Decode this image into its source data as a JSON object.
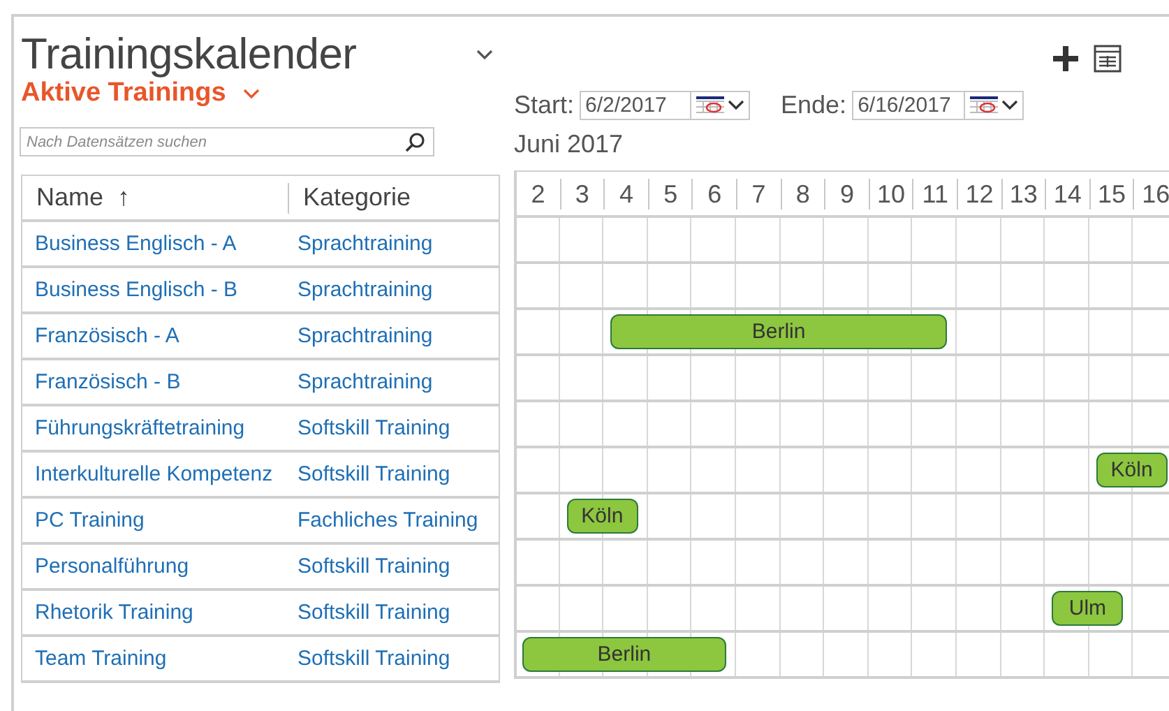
{
  "header": {
    "title": "Trainingskalender",
    "view": "Aktive Trainings"
  },
  "search": {
    "placeholder": "Nach Datensätzen suchen"
  },
  "filters": {
    "start_label": "Start:",
    "start_value": "6/2/2017",
    "end_label": "Ende:",
    "end_value": "6/16/2017"
  },
  "month": "Juni 2017",
  "table": {
    "columns": [
      {
        "label": "Name",
        "sort": "↑"
      },
      {
        "label": "Kategorie"
      }
    ],
    "rows": [
      {
        "name": "Business Englisch - A",
        "category": "Sprachtraining",
        "events": []
      },
      {
        "name": "Business Englisch - B",
        "category": "Sprachtraining",
        "events": []
      },
      {
        "name": "Französisch - A",
        "category": "Sprachtraining",
        "events": [
          {
            "label": "Berlin",
            "covers": [
              false,
              false,
              true,
              true,
              true,
              true,
              true,
              true,
              true,
              true,
              false,
              false,
              false,
              false,
              false
            ]
          }
        ]
      },
      {
        "name": "Französisch - B",
        "category": "Sprachtraining",
        "events": []
      },
      {
        "name": "Führungskräftetraining",
        "category": "Softskill Training",
        "events": []
      },
      {
        "name": "Interkulturelle Kompetenz",
        "category": "Softskill Training",
        "events": [
          {
            "label": "Köln",
            "covers": [
              false,
              false,
              false,
              false,
              false,
              false,
              false,
              false,
              false,
              false,
              false,
              false,
              false,
              true,
              true
            ]
          }
        ]
      },
      {
        "name": "PC Training",
        "category": "Fachliches Training",
        "events": [
          {
            "label": "Köln",
            "covers": [
              false,
              true,
              true,
              false,
              false,
              false,
              false,
              false,
              false,
              false,
              false,
              false,
              false,
              false,
              false
            ]
          }
        ]
      },
      {
        "name": "Personalführung",
        "category": "Softskill Training",
        "events": []
      },
      {
        "name": "Rhetorik Training",
        "category": "Softskill Training",
        "events": [
          {
            "label": "Ulm",
            "covers": [
              false,
              false,
              false,
              false,
              false,
              false,
              false,
              false,
              false,
              false,
              false,
              false,
              true,
              true,
              false
            ]
          }
        ]
      },
      {
        "name": "Team Training",
        "category": "Softskill Training",
        "events": [
          {
            "label": "Berlin",
            "covers": [
              true,
              true,
              true,
              true,
              true,
              false,
              false,
              false,
              false,
              false,
              false,
              false,
              false,
              false,
              false
            ]
          }
        ]
      }
    ]
  },
  "days": [
    "2",
    "3",
    "4",
    "5",
    "6",
    "7",
    "8",
    "9",
    "10",
    "11",
    "12",
    "13",
    "14",
    "15",
    "16"
  ]
}
